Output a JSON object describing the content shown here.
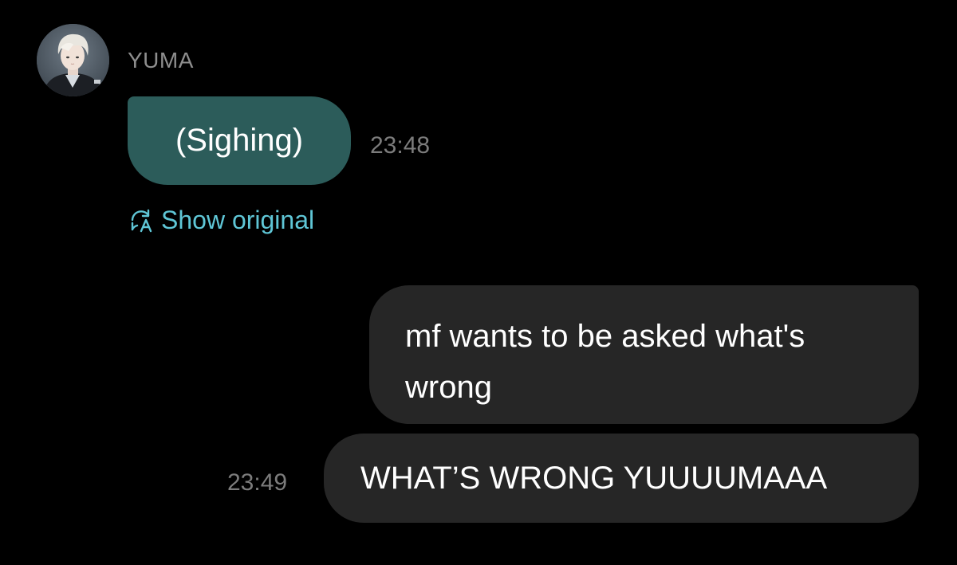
{
  "contact": {
    "name": "YUMA",
    "avatar": "avatar-photo"
  },
  "messages": [
    {
      "direction": "incoming",
      "text": "(Sighing)",
      "time": "23:48",
      "translation_link": {
        "icon": "translate-icon",
        "label": "Show original"
      }
    },
    {
      "direction": "outgoing",
      "text": "mf wants to be asked what's wrong"
    },
    {
      "direction": "outgoing",
      "text": "WHAT’S WRONG YUUUUMAAA",
      "time": "23:49"
    }
  ],
  "colors": {
    "background": "#000000",
    "incoming_bubble": "#2c5c5a",
    "outgoing_bubble": "#262626",
    "link": "#5fc6d6",
    "timestamp": "#7c7c7c",
    "sender_name": "#8e8e8e"
  }
}
